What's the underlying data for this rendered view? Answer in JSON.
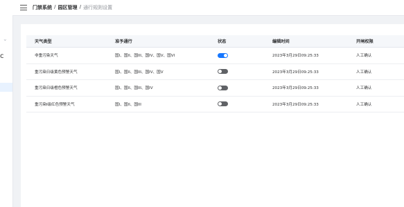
{
  "sidebar": {
    "partial_text": "c",
    "chevron_icon": "chevron-down-icon"
  },
  "header": {
    "menu_icon": "hamburger-menu-icon",
    "breadcrumb": {
      "level1": "门禁系统",
      "level2": "园区管理",
      "current": "通行规则设置",
      "separator": "/"
    }
  },
  "table": {
    "columns": {
      "weather_type": "天气类型",
      "allowed_pass": "准予通行",
      "status": "状态",
      "edit_time": "编辑时间",
      "gate_permission": "开闸权限"
    },
    "rows": [
      {
        "weather_type": "非重污染天气",
        "allowed_pass": "国I、国II、国III、国IV、国V、国VI",
        "status_on": true,
        "edit_time": "2023年3月29日09:25:33",
        "gate_permission": "人工确认"
      },
      {
        "weather_type": "重污染日级黄色预警天气",
        "allowed_pass": "国I、国II、国III、国IV、国V",
        "status_on": false,
        "edit_time": "2023年3月29日09:25:33",
        "gate_permission": "人工确认"
      },
      {
        "weather_type": "重污染日级橙色预警天气",
        "allowed_pass": "国I、国II、国III、国IV",
        "status_on": false,
        "edit_time": "2023年3月29日09:25:33",
        "gate_permission": "人工确认"
      },
      {
        "weather_type": "重污染Ⅰ级红色预警天气",
        "allowed_pass": "国I、国II、国III",
        "status_on": false,
        "edit_time": "2023年3月29日09:25:33",
        "gate_permission": "人工确认"
      }
    ]
  },
  "colors": {
    "accent": "#1677ff",
    "toggle_off": "#606266",
    "background": "#f0f2f5"
  }
}
